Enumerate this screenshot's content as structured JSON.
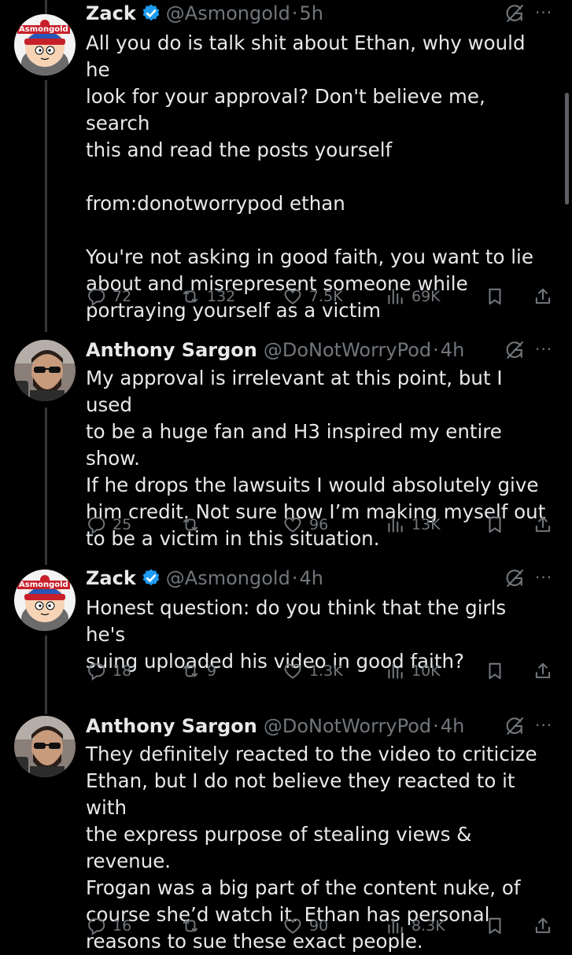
{
  "colors": {
    "background": "#000000",
    "text": "#e7e9ea",
    "muted": "#71767b",
    "verified": "#1d9bf0",
    "thread_line": "#333639"
  },
  "tweets": [
    {
      "avatar_label": "Asmongold",
      "avatar_icon": "south-park-character-avatar",
      "name": "Zack",
      "verified": true,
      "handle": "@Asmongold",
      "separator": "·",
      "time": "5h",
      "text": "All you do is talk shit about Ethan, why would he\nlook for your approval? Don't believe me, search\nthis and read the posts yourself\n\nfrom:donotworrypod ethan\n\nYou're not asking in good faith, you want to lie\nabout and misrepresent someone while\nportraying yourself as a victim",
      "replies": "72",
      "reposts": "132",
      "likes": "7.5K",
      "views": "69K"
    },
    {
      "avatar_icon": "bearded-man-sunglasses-avatar",
      "name": "Anthony Sargon",
      "verified": false,
      "handle": "@DoNotWorryPod",
      "separator": "·",
      "time": "4h",
      "text": "My approval is irrelevant at this point, but I used\nto be a huge fan and H3 inspired my entire show.\nIf he drops the lawsuits I would absolutely give\nhim credit. Not sure how I’m making myself out\nto be a victim in this situation.",
      "replies": "25",
      "reposts": "",
      "likes": "96",
      "views": "13K"
    },
    {
      "avatar_label": "Asmongold",
      "avatar_icon": "south-park-character-avatar",
      "name": "Zack",
      "verified": true,
      "handle": "@Asmongold",
      "separator": "·",
      "time": "4h",
      "text": "Honest question: do you think that the girls he's\nsuing uploaded his video in good faith?",
      "replies": "18",
      "reposts": "9",
      "likes": "1.3K",
      "views": "10K"
    },
    {
      "avatar_icon": "bearded-man-sunglasses-avatar",
      "name": "Anthony Sargon",
      "verified": false,
      "handle": "@DoNotWorryPod",
      "separator": "·",
      "time": "4h",
      "text": "They definitely reacted to the video to criticize\nEthan, but I do not believe they reacted to it with\nthe express purpose of stealing views & revenue.\nFrogan was a big part of the content nuke, of\ncourse she’d watch it. Ethan has personal\nreasons to sue these exact people.",
      "replies": "16",
      "reposts": "",
      "likes": "90",
      "views": "8.3K"
    }
  ],
  "more_label": "···"
}
